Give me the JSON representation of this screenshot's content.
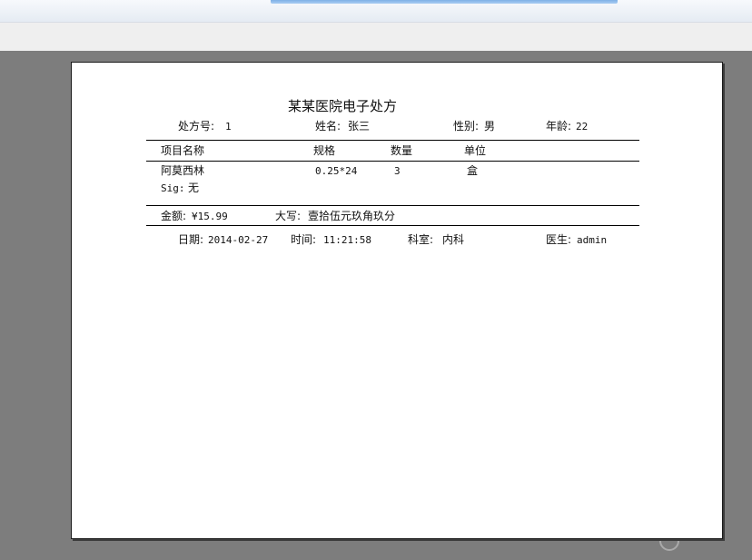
{
  "prescription": {
    "title": "某某医院电子处方",
    "header": {
      "rx_no_label": "处方号:",
      "rx_no": "1",
      "name_label": "姓名:",
      "name": "张三",
      "gender_label": "性别:",
      "gender": "男",
      "age_label": "年龄:",
      "age": "22"
    },
    "columns": {
      "item": "项目名称",
      "spec": "规格",
      "qty": "数量",
      "unit": "单位"
    },
    "rows": [
      {
        "item": "阿莫西林",
        "spec": "0.25*24",
        "qty": "3",
        "unit": "盒"
      }
    ],
    "sig_label": "Sig:",
    "sig": "无",
    "amount_label": "金额:",
    "amount": "¥15.99",
    "uppercase_label": "大写:",
    "uppercase": "壹拾伍元玖角玖分",
    "footer": {
      "date_label": "日期:",
      "date": "2014-02-27",
      "time_label": "时间:",
      "time": "11:21:58",
      "dept_label": "科室:",
      "dept": "内科",
      "doctor_label": "医生:",
      "doctor": "admin"
    }
  }
}
